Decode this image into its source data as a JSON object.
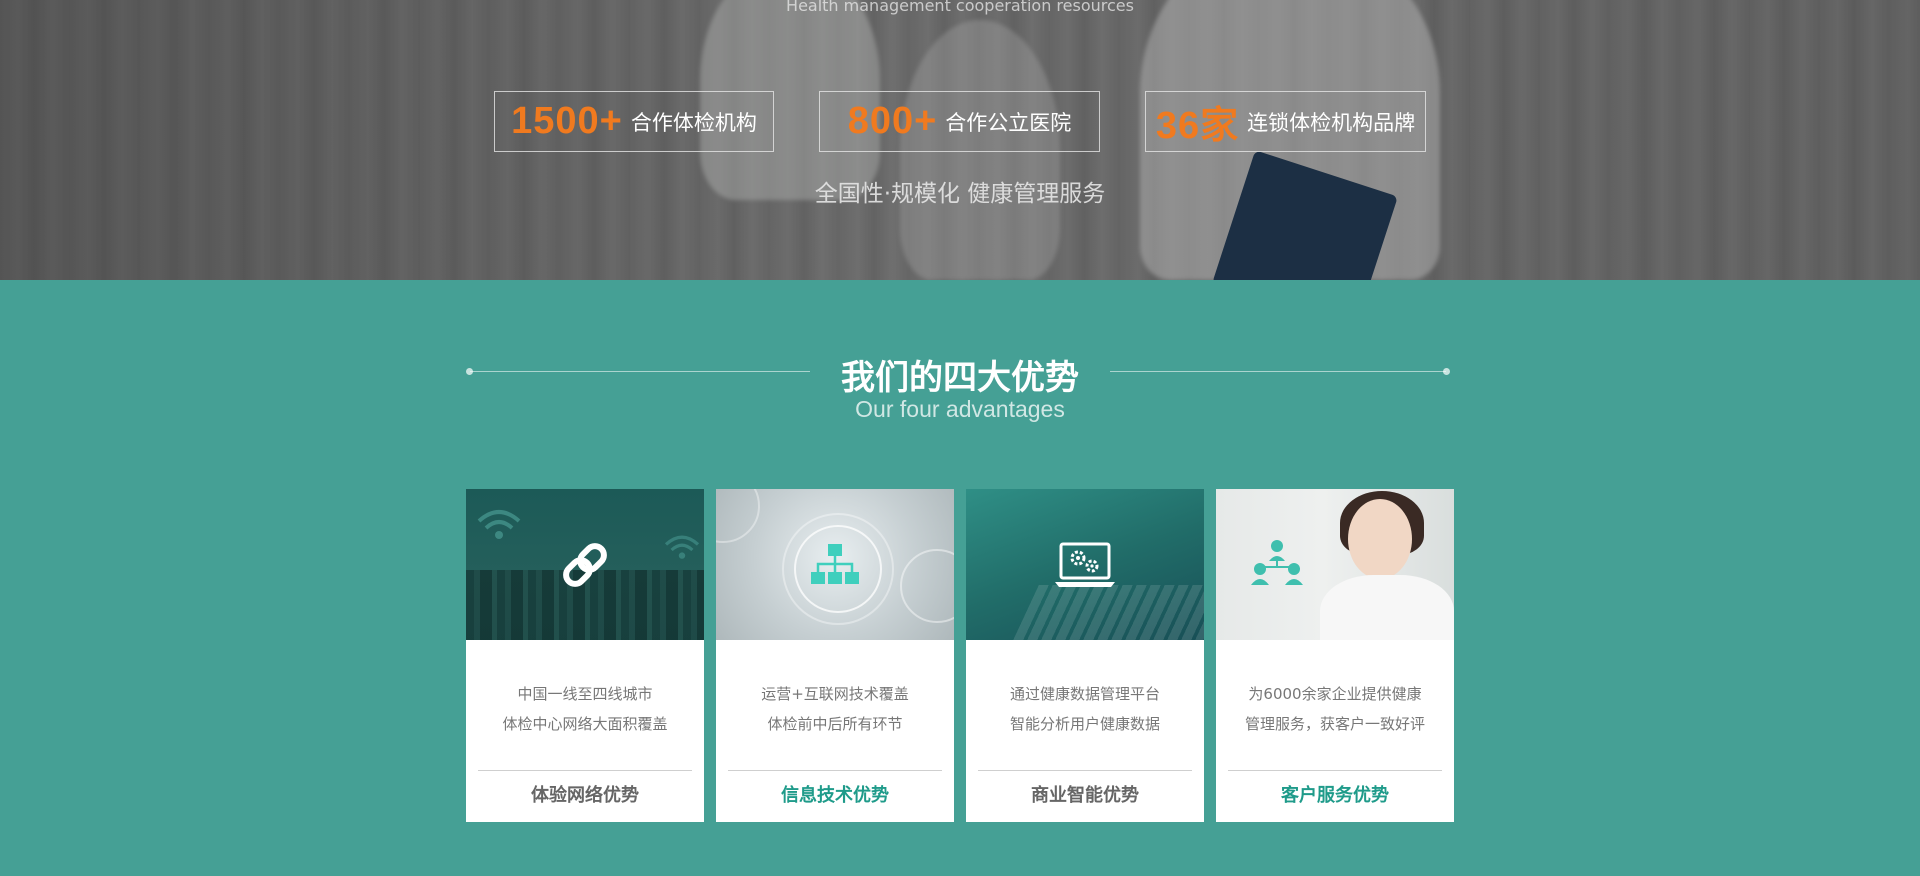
{
  "hero": {
    "subtitle": "Health management cooperation resources",
    "stats": [
      {
        "number": "1500+",
        "label": "合作体检机构"
      },
      {
        "number": "800+",
        "label": "合作公立医院"
      },
      {
        "number": "36家",
        "label": "连锁体检机构品牌"
      }
    ],
    "tagline": "全国性·规模化 健康管理服务"
  },
  "section": {
    "title": "我们的四大优势",
    "subtitle": "Our four advantages"
  },
  "cards": [
    {
      "icon": "link-icon",
      "line1": "中国一线至四线城市",
      "line2": "体检中心网络大面积覆盖",
      "title": "体验网络优势"
    },
    {
      "icon": "network-hierarchy-icon",
      "line1": "运营+互联网技术覆盖",
      "line2": "体检前中后所有环节",
      "title": "信息技术优势"
    },
    {
      "icon": "laptop-gears-icon",
      "line1": "通过健康数据管理平台",
      "line2": "智能分析用户健康数据",
      "title": "商业智能优势"
    },
    {
      "icon": "people-group-icon",
      "line1": "为6000余家企业提供健康",
      "line2": "管理服务，获客户一致好评",
      "title": "客户服务优势"
    }
  ],
  "colors": {
    "accent_orange": "#f07a1f",
    "section_bg": "#45a095",
    "accent_teal": "#1f9b8a"
  }
}
